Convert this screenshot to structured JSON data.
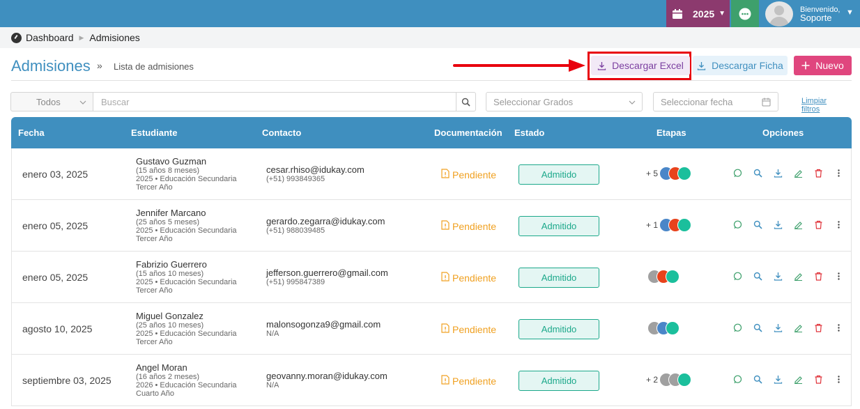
{
  "topbar": {
    "year": "2025",
    "welcome": "Bienvenido,",
    "user_name": "Soporte"
  },
  "breadcrumb": {
    "items": [
      "Dashboard",
      "Admisiones"
    ]
  },
  "page": {
    "title": "Admisiones",
    "separator": "»",
    "subtitle": "Lista de admisiones"
  },
  "actions": {
    "excel": "Descargar Excel",
    "ficha": "Descargar Ficha",
    "nuevo": "Nuevo"
  },
  "filters": {
    "tipo": "Todos",
    "search_placeholder": "Buscar",
    "grados_placeholder": "Seleccionar Grados",
    "fecha_placeholder": "Seleccionar fecha",
    "clear": "Limpiar filtros"
  },
  "table": {
    "columns": [
      "Fecha",
      "Estudiante",
      "Contacto",
      "Documentación",
      "Estado",
      "Etapas",
      "Opciones"
    ],
    "rows": [
      {
        "fecha": "enero 03, 2025",
        "nombre": "Gustavo Guzman",
        "edad": "(15 años 8 meses)",
        "grado": "2025 • Educación Secundaria",
        "anio": "Tercer Año",
        "email": "cesar.rhiso@idukay.com",
        "telefono": "(+51) 993849365",
        "doc": "Pendiente",
        "estado": "Admitido",
        "etapas_count": "+ 5",
        "etapas_colors": [
          "#4a86c8",
          "#e8431c",
          "#1bbf9c"
        ]
      },
      {
        "fecha": "enero 05, 2025",
        "nombre": "Jennifer Marcano",
        "edad": "(25 años 5 meses)",
        "grado": "2025 • Educación Secundaria",
        "anio": "Tercer Año",
        "email": "gerardo.zegarra@idukay.com",
        "telefono": "(+51) 988039485",
        "doc": "Pendiente",
        "estado": "Admitido",
        "etapas_count": "+ 1",
        "etapas_colors": [
          "#4a86c8",
          "#e8431c",
          "#1bbf9c"
        ]
      },
      {
        "fecha": "enero 05, 2025",
        "nombre": "Fabrizio Guerrero",
        "edad": "(15 años 10 meses)",
        "grado": "2025 • Educación Secundaria",
        "anio": "Tercer Año",
        "email": "jefferson.guerrero@gmail.com",
        "telefono": "(+51) 995847389",
        "doc": "Pendiente",
        "estado": "Admitido",
        "etapas_count": "",
        "etapas_colors": [
          "#a0a0a0",
          "#e8431c",
          "#1bbf9c"
        ]
      },
      {
        "fecha": "agosto 10, 2025",
        "nombre": "Miguel Gonzalez",
        "edad": "(25 años 10 meses)",
        "grado": "2025 • Educación Secundaria",
        "anio": "Tercer Año",
        "email": "malonsogonza9@gmail.com",
        "telefono": "N/A",
        "doc": "Pendiente",
        "estado": "Admitido",
        "etapas_count": "",
        "etapas_colors": [
          "#a0a0a0",
          "#4a86c8",
          "#1bbf9c"
        ]
      },
      {
        "fecha": "septiembre 03, 2025",
        "nombre": "Angel Moran",
        "edad": "(16 años 2 meses)",
        "grado": "2026 • Educación Secundaria",
        "anio": "Cuarto Año",
        "email": "geovanny.moran@idukay.com",
        "telefono": "N/A",
        "doc": "Pendiente",
        "estado": "Admitido",
        "etapas_count": "+ 2",
        "etapas_colors": [
          "#a0a0a0",
          "#a0a0a0",
          "#1bbf9c"
        ]
      }
    ]
  },
  "colors": {
    "topbar": "#3f8fbf",
    "year_bg": "#8c3a6e",
    "chat_bg": "#3ea06c",
    "pending": "#f0a020",
    "admitted": "#1ba88a",
    "nuevo": "#e0467e"
  }
}
